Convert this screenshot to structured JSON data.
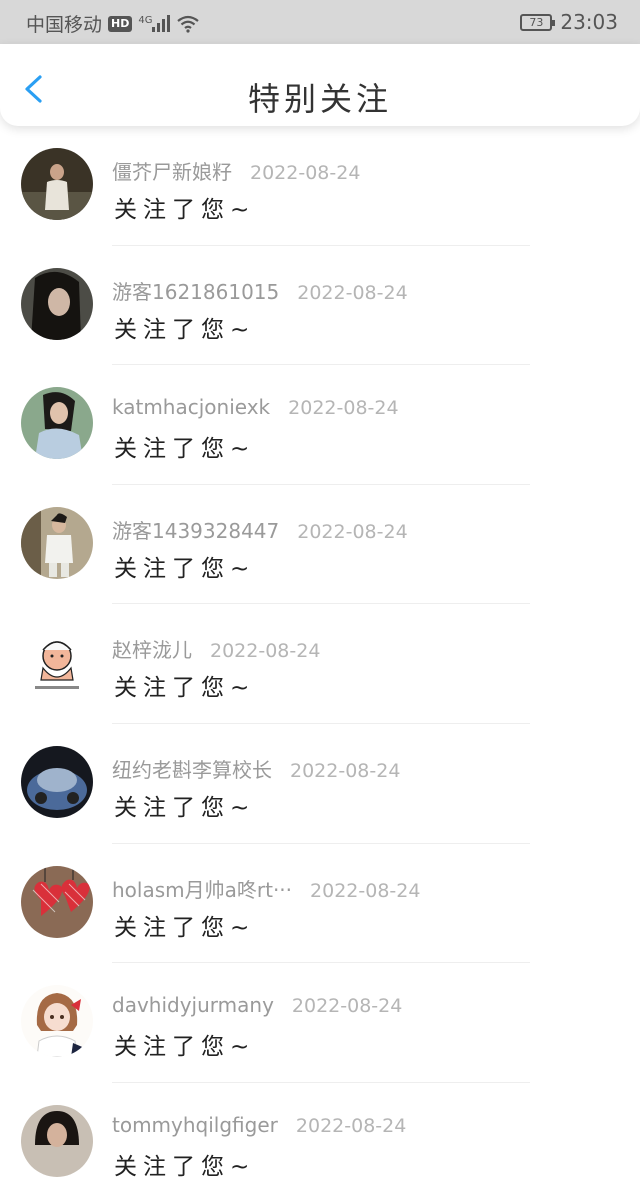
{
  "status_bar": {
    "carrier": "中国移动",
    "hd": "HD",
    "network": "4G",
    "battery": "73",
    "time": "23:03"
  },
  "header": {
    "title": "特别关注"
  },
  "items": [
    {
      "name": "僵芥尸新娘籽",
      "date": "2022-08-24",
      "message": "关注了您~"
    },
    {
      "name": "游客1621861015",
      "date": "2022-08-24",
      "message": "关注了您~"
    },
    {
      "name": "katmhacjoniexk",
      "date": "2022-08-24",
      "message": "关注了您~"
    },
    {
      "name": "游客1439328447",
      "date": "2022-08-24",
      "message": "关注了您~"
    },
    {
      "name": "赵梓泷儿",
      "date": "2022-08-24",
      "message": "关注了您~"
    },
    {
      "name": "纽约老斟李算校长",
      "date": "2022-08-24",
      "message": "关注了您~"
    },
    {
      "name": "holasm月帅a咚rt···",
      "date": "2022-08-24",
      "message": "关注了您~"
    },
    {
      "name": "davhidyjurmany",
      "date": "2022-08-24",
      "message": "关注了您~"
    },
    {
      "name": "tommyhqilgfiger",
      "date": "2022-08-24",
      "message": "关注了您~"
    }
  ]
}
